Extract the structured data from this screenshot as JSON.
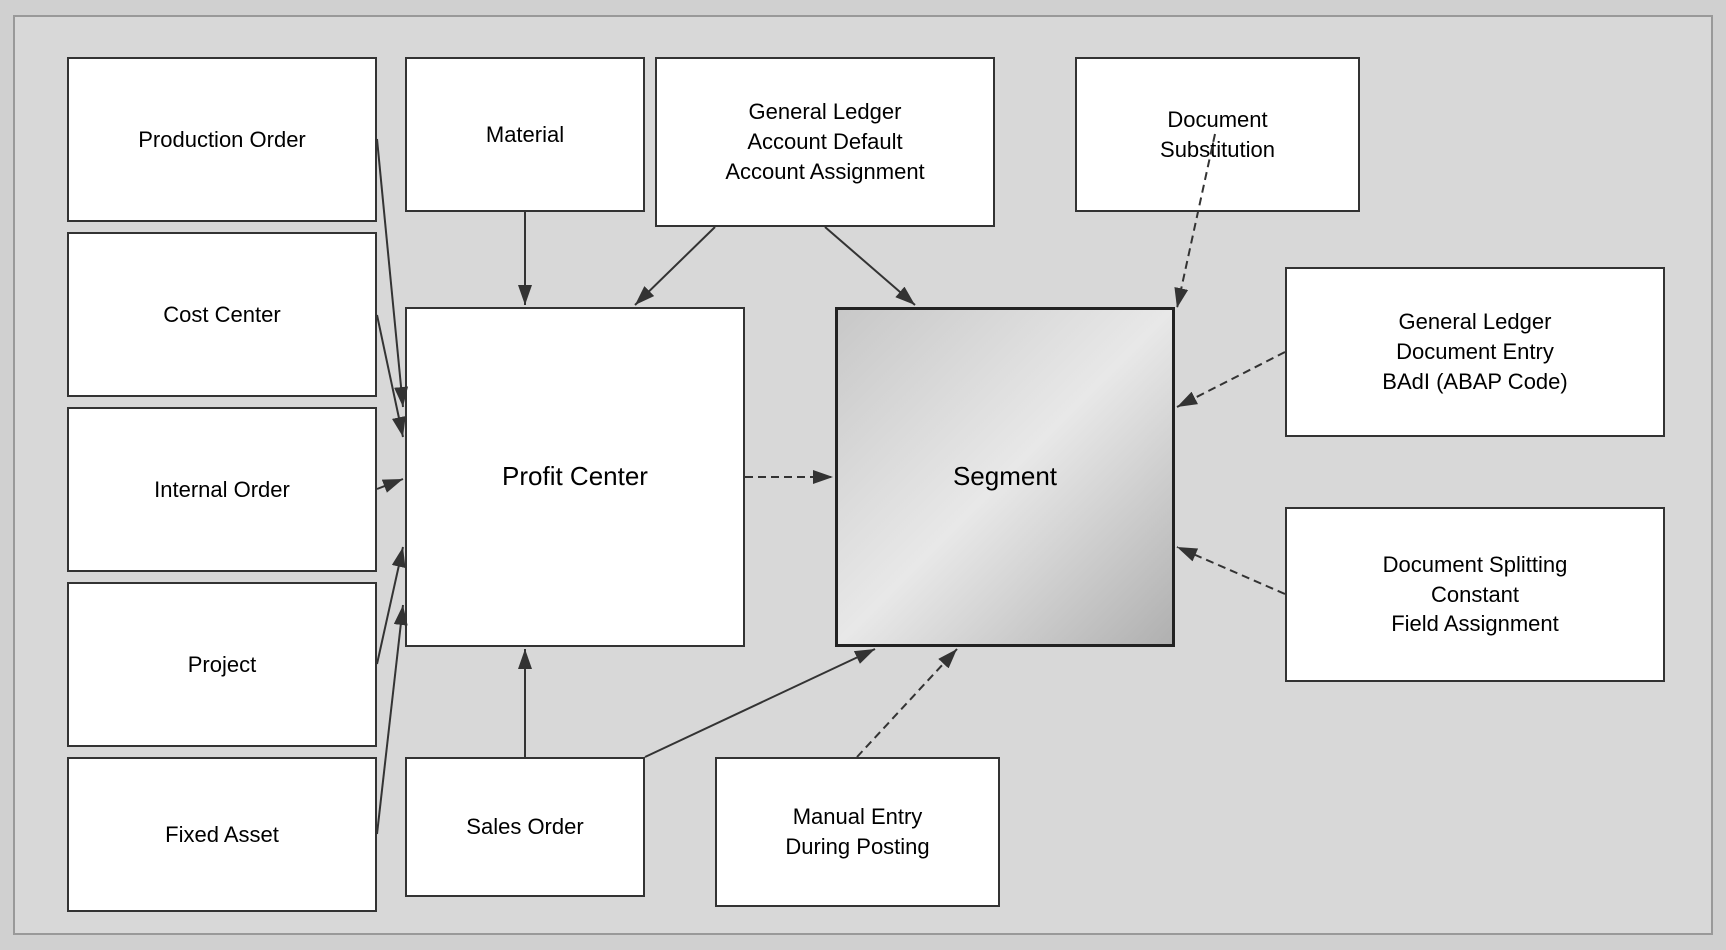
{
  "boxes": {
    "production_order": {
      "label": "Production Order"
    },
    "cost_center": {
      "label": "Cost Center"
    },
    "internal_order": {
      "label": "Internal Order"
    },
    "project": {
      "label": "Project"
    },
    "fixed_asset": {
      "label": "Fixed Asset"
    },
    "material": {
      "label": "Material"
    },
    "gl_account": {
      "label": "General Ledger\nAccount Default\nAccount Assignment"
    },
    "doc_substitution": {
      "label": "Document\nSubstitution"
    },
    "profit_center": {
      "label": "Profit Center"
    },
    "segment": {
      "label": "Segment"
    },
    "sales_order": {
      "label": "Sales Order"
    },
    "manual_entry": {
      "label": "Manual Entry\nDuring Posting"
    },
    "gl_badi": {
      "label": "General Ledger\nDocument Entry\nBAdI (ABAP Code)"
    },
    "doc_splitting": {
      "label": "Document Splitting\nConstant\nField Assignment"
    }
  }
}
